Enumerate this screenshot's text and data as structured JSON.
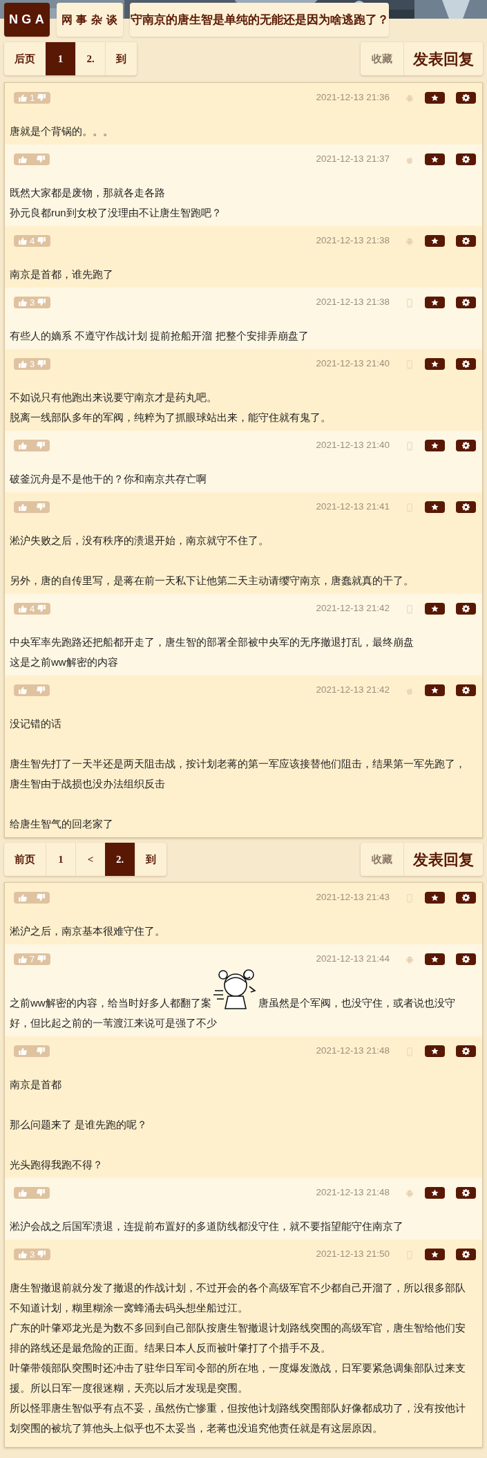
{
  "header": {
    "logo": "NGA",
    "forum": "网事杂谈",
    "title": "守南京的唐生智是单纯的无能还是因为啥逃跑了？"
  },
  "sections": [
    {
      "pager": {
        "pages": [
          {
            "label": "后页",
            "selected": false
          },
          {
            "label": "1",
            "selected": true
          },
          {
            "label": "2.",
            "selected": false
          },
          {
            "label": "到",
            "selected": false
          }
        ],
        "actions": [
          {
            "label": "收藏",
            "kind": "secondary"
          },
          {
            "label": "发表回复",
            "kind": "primary"
          }
        ]
      },
      "posts": [
        {
          "votes": "1",
          "time": "2021-12-13 21:36",
          "kind": "android",
          "paragraphs": [
            {
              "kind": "text",
              "lines": [
                "唐就是个背锅的。。。"
              ]
            }
          ]
        },
        {
          "time": "2021-12-13 21:37",
          "kind": "apple",
          "paragraphs": [
            {
              "kind": "text",
              "lines": [
                "既然大家都是废物，那就各走各路",
                "孙元良都run到女校了没理由不让唐生智跑吧？"
              ]
            }
          ]
        },
        {
          "votes": "4",
          "time": "2021-12-13 21:38",
          "kind": "android",
          "paragraphs": [
            {
              "kind": "text",
              "lines": [
                "南京是首都，谁先跑了"
              ]
            }
          ]
        },
        {
          "votes": "3",
          "time": "2021-12-13 21:38",
          "kind": "phone",
          "paragraphs": [
            {
              "kind": "text",
              "lines": [
                "有些人的嫡系 不遵守作战计划 提前抢船开溜 把整个安排弄崩盘了"
              ]
            }
          ]
        },
        {
          "votes": "3",
          "time": "2021-12-13 21:40",
          "kind": "phone",
          "paragraphs": [
            {
              "kind": "text",
              "lines": [
                "不如说只有他跑出来说要守南京才是药丸吧。",
                "脱离一线部队多年的军阀，纯粹为了抓眼球站出来，能守住就有鬼了。"
              ]
            }
          ]
        },
        {
          "time": "2021-12-13 21:40",
          "kind": "phone",
          "paragraphs": [
            {
              "kind": "text",
              "lines": [
                "破釜沉舟是不是他干的？你和南京共存亡啊"
              ]
            }
          ]
        },
        {
          "time": "2021-12-13 21:41",
          "kind": "phone",
          "paragraphs": [
            {
              "kind": "text",
              "lines": [
                "淞沪失败之后，没有秩序的溃退开始，南京就守不住了。"
              ]
            },
            {
              "kind": "text",
              "lines": [
                "另外，唐的自传里写，是蒋在前一天私下让他第二天主动请缨守南京，唐蠢就真的干了。"
              ]
            }
          ]
        },
        {
          "votes": "4",
          "time": "2021-12-13 21:42",
          "kind": "phone",
          "paragraphs": [
            {
              "kind": "text",
              "lines": [
                "中央军率先跑路还把船都开走了，唐生智的部署全部被中央军的无序撤退打乱，最终崩盘",
                "这是之前ww解密的内容"
              ]
            }
          ]
        },
        {
          "time": "2021-12-13 21:42",
          "kind": "apple",
          "paragraphs": [
            {
              "kind": "text",
              "lines": [
                "没记错的话"
              ]
            },
            {
              "kind": "text",
              "lines": [
                "唐生智先打了一天半还是两天阻击战，按计划老蒋的第一军应该接替他们阻击，结果第一军先跑了，唐生智由于战损也没办法组织反击"
              ]
            },
            {
              "kind": "text",
              "lines": [
                "给唐生智气的回老家了"
              ]
            }
          ]
        }
      ]
    },
    {
      "pager": {
        "pages": [
          {
            "label": "前页",
            "selected": false
          },
          {
            "label": "1",
            "selected": false
          },
          {
            "label": "<",
            "selected": false
          },
          {
            "label": "2.",
            "selected": true
          },
          {
            "label": "到",
            "selected": false
          }
        ],
        "actions": [
          {
            "label": "收藏",
            "kind": "secondary"
          },
          {
            "label": "发表回复",
            "kind": "primary"
          }
        ]
      },
      "posts": [
        {
          "time": "2021-12-13 21:43",
          "kind": "phone",
          "paragraphs": [
            {
              "kind": "text",
              "lines": [
                "淞沪之后，南京基本很难守住了。"
              ]
            }
          ]
        },
        {
          "votes": "7",
          "time": "2021-12-13 21:44",
          "kind": "android",
          "paragraphs": [
            {
              "kind": "sticker",
              "before": "之前ww解密的内容，给当时好多人都翻了案",
              "after": "唐虽然是个军阀，也没守住，或者说也没守",
              "continued": "好，但比起之前的一苇渡江来说可是强了不少"
            }
          ]
        },
        {
          "time": "2021-12-13 21:48",
          "kind": "phone",
          "paragraphs": [
            {
              "kind": "text",
              "lines": [
                "南京是首都"
              ]
            },
            {
              "kind": "text",
              "lines": [
                "那么问题来了 是谁先跑的呢？"
              ]
            },
            {
              "kind": "text",
              "lines": [
                "光头跑得我跑不得？"
              ]
            }
          ]
        },
        {
          "time": "2021-12-13 21:48",
          "kind": "android",
          "paragraphs": [
            {
              "kind": "text",
              "lines": [
                "淞沪会战之后国军溃退，连提前布置好的多道防线都没守住，就不要指望能守住南京了"
              ]
            }
          ]
        },
        {
          "votes": "3",
          "time": "2021-12-13 21:50",
          "kind": "phone",
          "paragraphs": [
            {
              "kind": "text",
              "lines": [
                "唐生智撤退前就分发了撤退的作战计划，不过开会的各个高级军官不少都自己开溜了，所以很多部队不知道计划，糊里糊涂一窝蜂涌去码头想坐船过江。",
                "广东的叶肇邓龙光是为数不多回到自己部队按唐生智撤退计划路线突围的高级军官，唐生智给他们安排的路线还是最危险的正面。结果日本人反而被叶肇打了个措手不及。",
                "叶肇带领部队突围时还冲击了驻华日军司令部的所在地，一度爆发激战，日军要紧急调集部队过来支援。所以日军一度很迷糊，天亮以后才发现是突围。",
                "所以怪罪唐生智似乎有点不妥，虽然伤亡惨重，但按他计划路线突围部队好像都成功了，没有按他计划突围的被坑了算他头上似乎也不太妥当，老蒋也没追究他责任就是有这层原因。"
              ]
            }
          ]
        }
      ]
    }
  ]
}
